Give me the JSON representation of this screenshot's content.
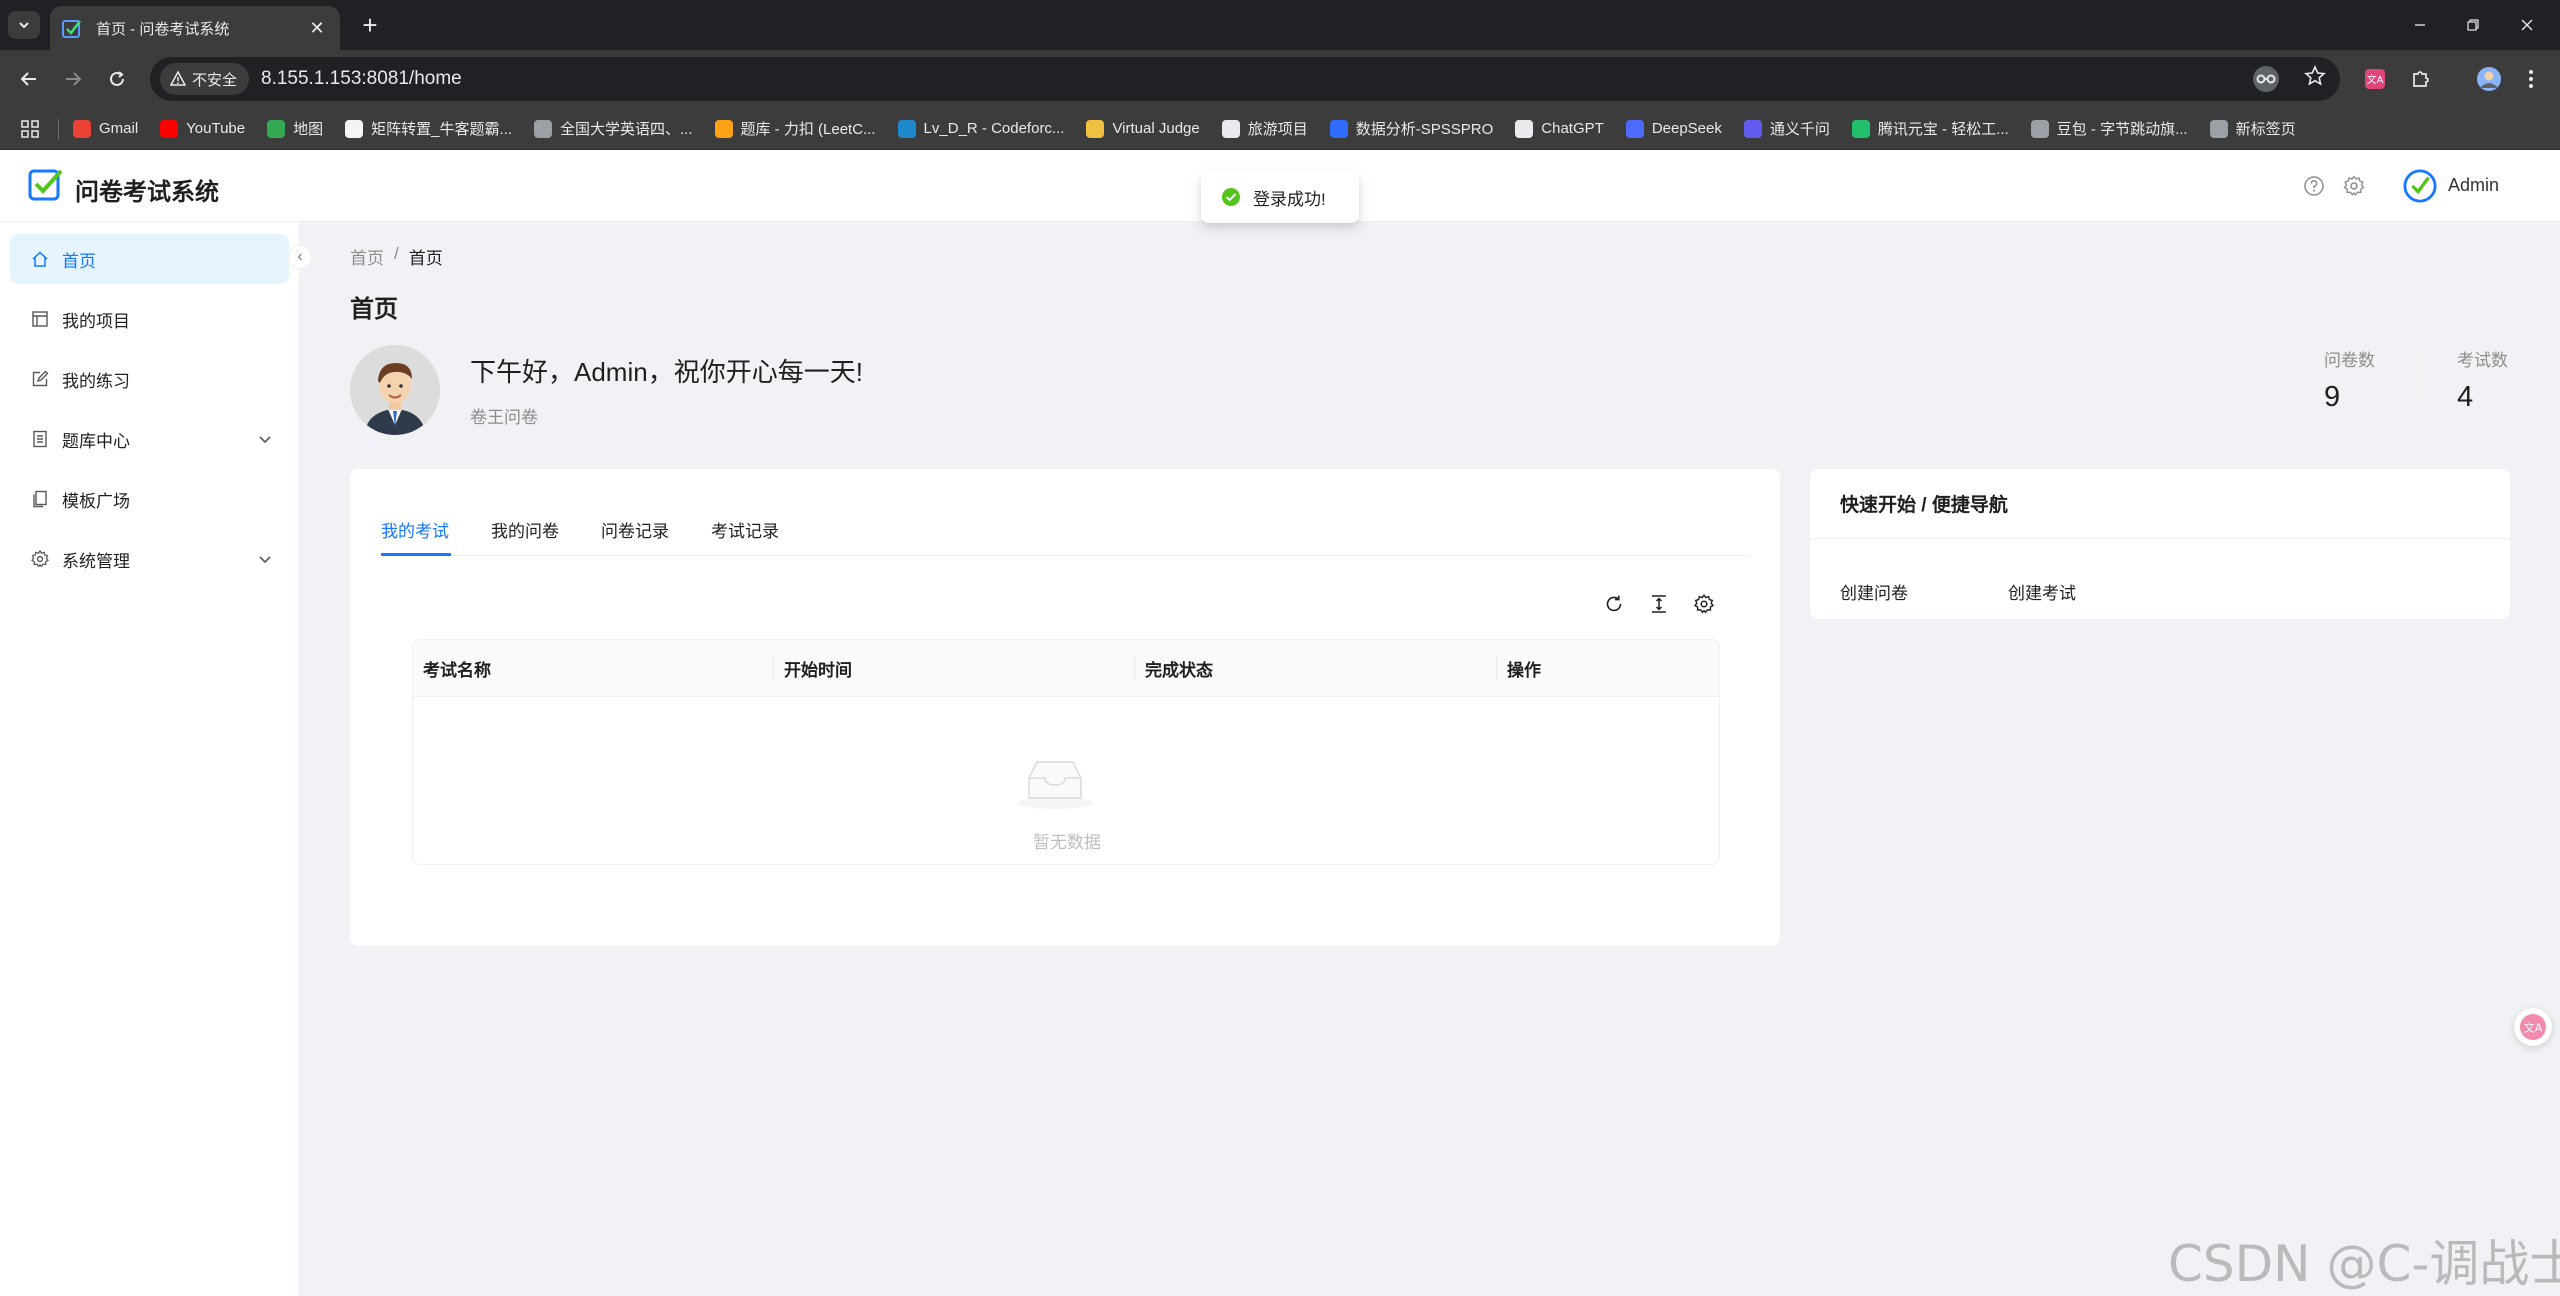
{
  "browser": {
    "tab_title": "首页 - 问卷考试系统",
    "security_label": "不安全",
    "url": "8.155.1.153:8081/home",
    "bookmarks": [
      {
        "label": "Gmail",
        "icon": "gmail-icon",
        "color": "#ea4335"
      },
      {
        "label": "YouTube",
        "icon": "youtube-icon",
        "color": "#ff0000"
      },
      {
        "label": "地图",
        "icon": "maps-icon",
        "color": "#34a853"
      },
      {
        "label": "矩阵转置_牛客题霸...",
        "icon": "nowcoder-icon",
        "color": "#f4f4f4"
      },
      {
        "label": "全国大学英语四、...",
        "icon": "globe-icon",
        "color": "#9aa0a6"
      },
      {
        "label": "题库 - 力扣 (LeetC...",
        "icon": "leetcode-icon",
        "color": "#ffa116"
      },
      {
        "label": "Lv_D_R - Codeforc...",
        "icon": "codeforces-icon",
        "color": "#1f8acb"
      },
      {
        "label": "Virtual Judge",
        "icon": "vjudge-icon",
        "color": "#f0c040"
      },
      {
        "label": "旅游项目",
        "icon": "folder-icon",
        "color": "#e8eaed"
      },
      {
        "label": "数据分析-SPSSPRO",
        "icon": "spsspro-icon",
        "color": "#2f6bff"
      },
      {
        "label": "ChatGPT",
        "icon": "chatgpt-icon",
        "color": "#e8eaed"
      },
      {
        "label": "DeepSeek",
        "icon": "deepseek-icon",
        "color": "#4d6bfe"
      },
      {
        "label": "通义千问",
        "icon": "tongyi-icon",
        "color": "#615ced"
      },
      {
        "label": "腾讯元宝 - 轻松工...",
        "icon": "yuanbao-icon",
        "color": "#23c06b"
      },
      {
        "label": "豆包 - 字节跳动旗...",
        "icon": "doubao-icon",
        "color": "#9aa0a6"
      },
      {
        "label": "新标签页",
        "icon": "globe-icon",
        "color": "#9aa0a6"
      }
    ]
  },
  "app": {
    "title": "问卷考试系统",
    "username": "Admin",
    "toast": "登录成功!",
    "sidebar": [
      {
        "label": "首页",
        "icon": "home-icon",
        "active": true,
        "expandable": false
      },
      {
        "label": "我的项目",
        "icon": "project-icon",
        "active": false,
        "expandable": false
      },
      {
        "label": "我的练习",
        "icon": "edit-icon",
        "active": false,
        "expandable": false
      },
      {
        "label": "题库中心",
        "icon": "question-bank-icon",
        "active": false,
        "expandable": true
      },
      {
        "label": "模板广场",
        "icon": "template-icon",
        "active": false,
        "expandable": false
      },
      {
        "label": "系统管理",
        "icon": "settings-icon",
        "active": false,
        "expandable": true
      }
    ],
    "breadcrumb": [
      "首页",
      "首页"
    ],
    "breadcrumb_sep": "/",
    "page_title": "首页",
    "greeting": "下午好，Admin，祝你开心每一天!",
    "sub_greeting": "卷王问卷",
    "stats": [
      {
        "label": "问卷数",
        "value": "9"
      },
      {
        "label": "考试数",
        "value": "4"
      }
    ],
    "tabs": [
      "我的考试",
      "我的问卷",
      "问卷记录",
      "考试记录"
    ],
    "active_tab": 0,
    "table": {
      "columns": [
        "考试名称",
        "开始时间",
        "完成状态",
        "操作"
      ],
      "empty_text": "暂无数据"
    },
    "quick": {
      "title": "快速开始 / 便捷导航",
      "links": [
        "创建问卷",
        "创建考试"
      ]
    }
  },
  "watermark": "CSDN @C-调战士",
  "colors": {
    "primary": "#1677ff",
    "success": "#52c41a",
    "browser_dark": "#202124",
    "browser_toolbar": "#3c3c3c"
  }
}
